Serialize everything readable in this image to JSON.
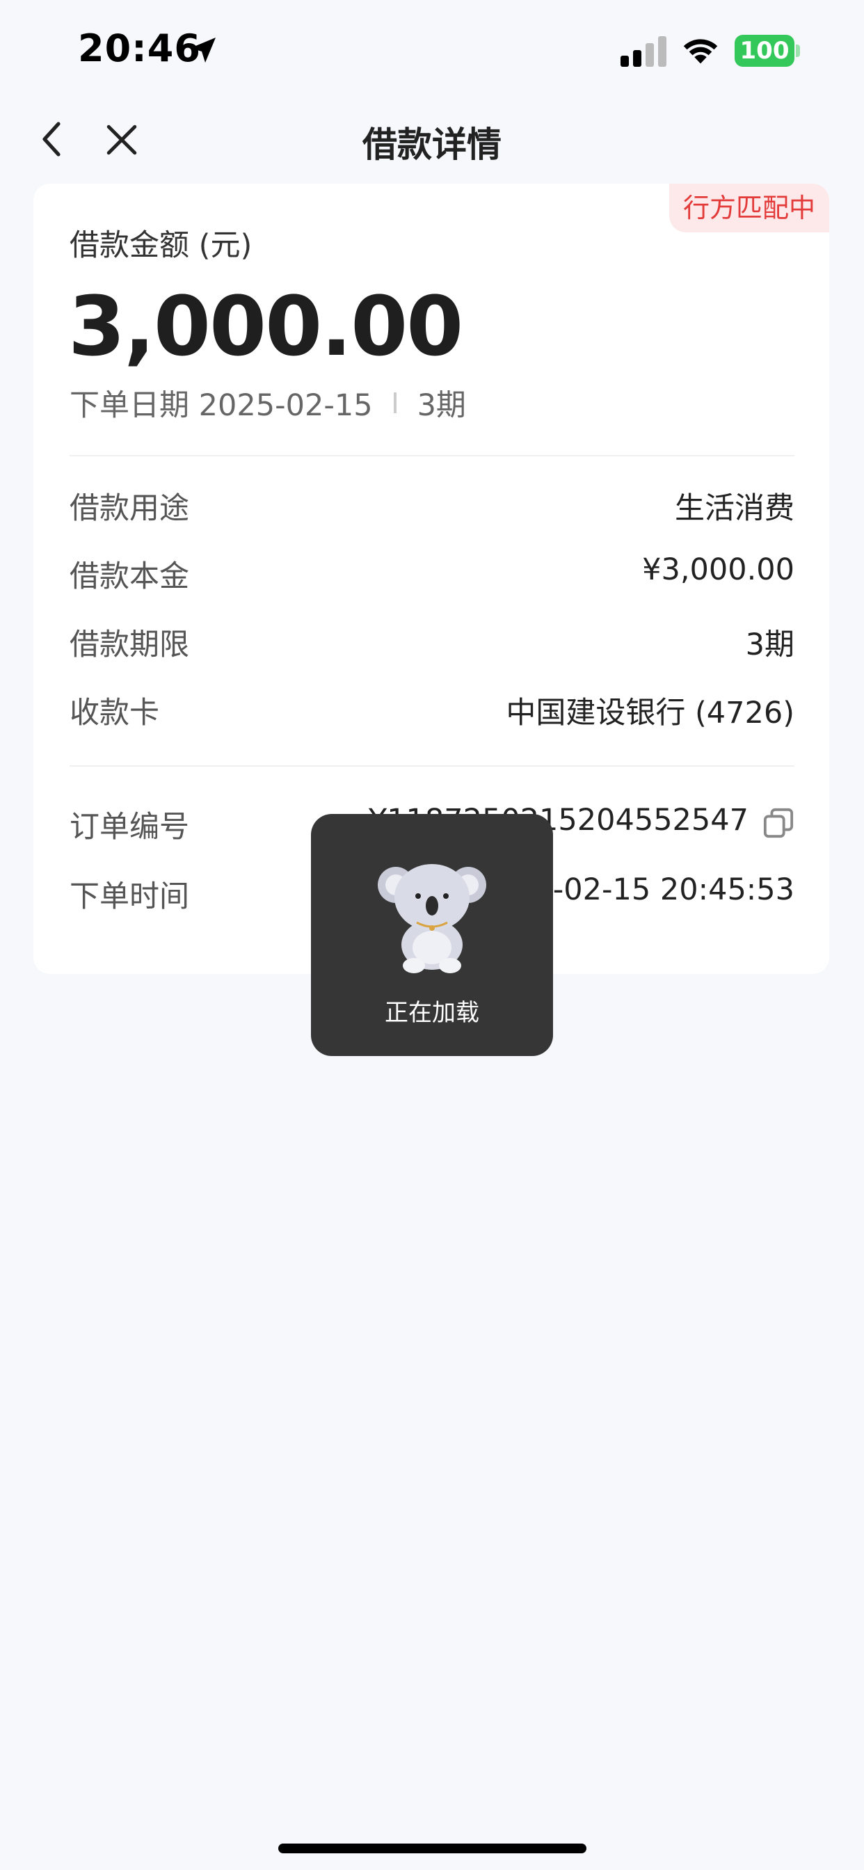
{
  "status_bar": {
    "time": "20:46",
    "battery": "100",
    "icons": [
      "location-arrow-icon",
      "cellular-signal-icon",
      "wifi-icon",
      "battery-icon"
    ],
    "battery_color": "#34c759"
  },
  "nav": {
    "title": "借款详情",
    "back_icon": "chevron-left-icon",
    "close_icon": "close-icon"
  },
  "card": {
    "status_badge": "行方匹配中",
    "amount_label": "借款金额 (元)",
    "amount_value": "3,000.00",
    "order_date_label": "下单日期 2025-02-15",
    "periods": "3期",
    "details": [
      {
        "label": "借款用途",
        "value": "生活消费"
      },
      {
        "label": "借款本金",
        "value": "¥3,000.00"
      },
      {
        "label": "借款期限",
        "value": "3期"
      },
      {
        "label": "收款卡",
        "value": "中国建设银行 (4726)"
      }
    ],
    "order": [
      {
        "label": "订单编号",
        "value": "Y11872502152045525​47"
      },
      {
        "label": "下单时间",
        "value": "2025-02-15 20:45:53"
      }
    ],
    "copy_icon": "copy-icon",
    "badge_color": "#e33a3a"
  },
  "loading": {
    "text": "正在加载",
    "icon": "koala-mascot-icon"
  }
}
